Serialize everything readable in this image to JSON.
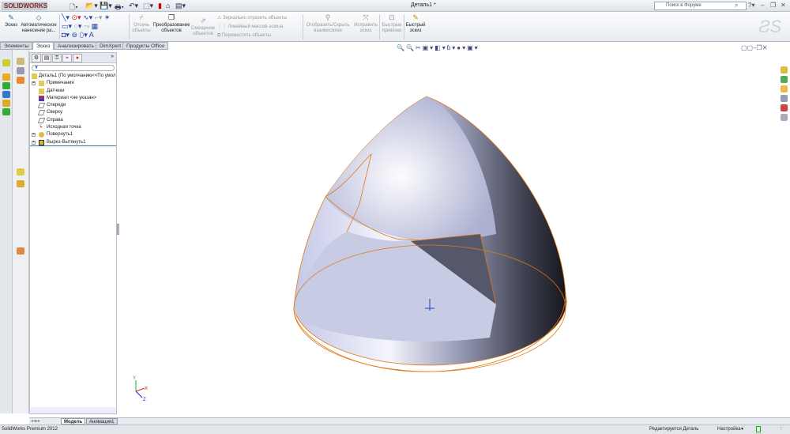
{
  "app": {
    "logo": "SOLIDWORKS",
    "title": "Деталь1 *",
    "search_placeholder": "Поиск в Форуме"
  },
  "ribbon": {
    "sketch": "Эскиз",
    "smart_dim": "Автоматическое нанесение ра...",
    "trim": "Отсечь объекты",
    "convert": "Преобразование объектов",
    "offset": "Смещение объектов",
    "mirror": "Зеркально отразить объекты",
    "linear_pattern": "Линейный массив эскиза",
    "move": "Переместить объекты",
    "display_relations": "Отобразить/Скрыть взаимосвязи",
    "repair": "Исправить эскиз",
    "quick_snaps": "Быстрые привязки",
    "rapid_sketch": "Быстрый эскиз"
  },
  "tabs": [
    "Элементы",
    "Эскиз",
    "Анализировать",
    "DimXpert",
    "Продукты Office"
  ],
  "active_tab": 1,
  "tree": {
    "root": "Деталь1  (По умолчанию<<По умол...",
    "items": [
      "Примечания",
      "Датчики",
      "Материал <не указан>",
      "Спереди",
      "Сверху",
      "Справа",
      "Исходная точка",
      "Повернуть1",
      "Вырез-Вытянуть1"
    ]
  },
  "bottom_tabs": [
    "Модель",
    "Анимация1"
  ],
  "status": {
    "product": "SolidWorks Premium 2012",
    "mode": "Редактируется Деталь",
    "custom": "Настройка"
  },
  "colors": {
    "edge": "#e07a10",
    "accent": "#3a6fb0"
  }
}
